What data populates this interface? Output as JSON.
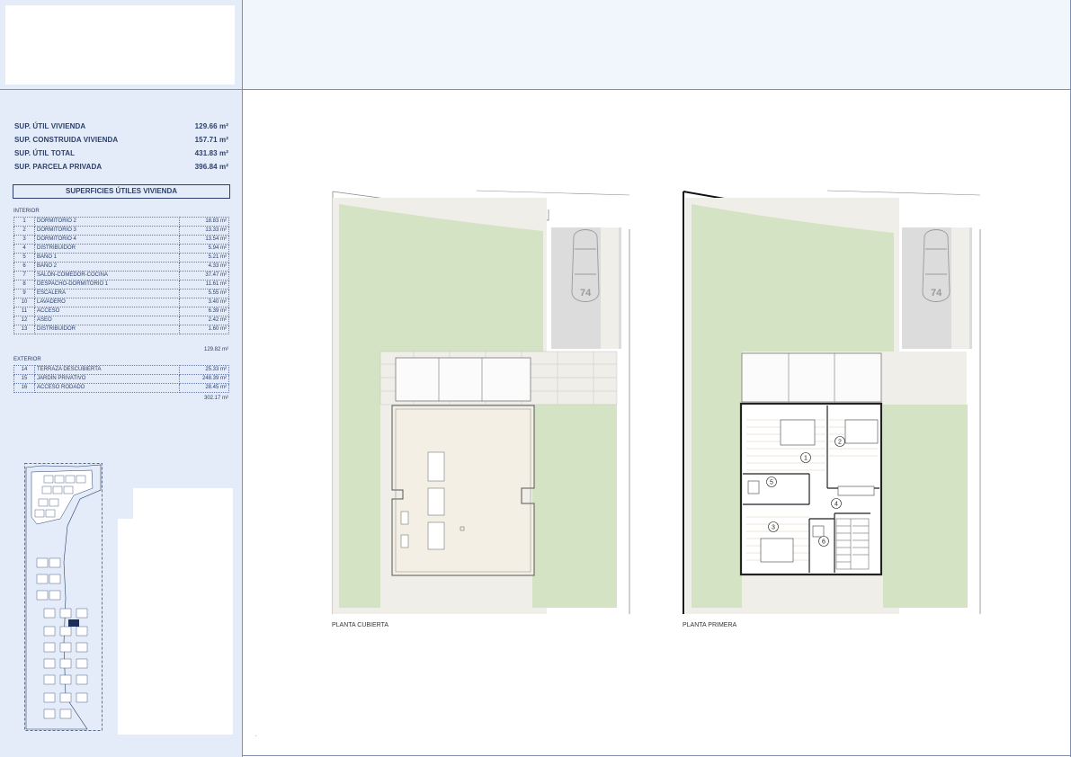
{
  "summary": [
    {
      "label": "SUP. ÚTIL VIVIENDA",
      "value": "129.66 m²"
    },
    {
      "label": "SUP. CONSTRUIDA VIVIENDA",
      "value": "157.71 m²"
    },
    {
      "label": "SUP. ÚTIL TOTAL",
      "value": "431.83 m²"
    },
    {
      "label": "SUP. PARCELA PRIVADA",
      "value": "396.84 m²"
    }
  ],
  "surfaces_title": "SUPERFICIES ÚTILES VIVIENDA",
  "interior": {
    "label": "INTERIOR",
    "rooms": [
      {
        "n": "1",
        "name": "DORMITORIO 2",
        "area": "18.83 m²"
      },
      {
        "n": "2",
        "name": "DORMITORIO 3",
        "area": "13.33 m²"
      },
      {
        "n": "3",
        "name": "DORMITORIO 4",
        "area": "13.54 m²"
      },
      {
        "n": "4",
        "name": "DISTRIBUIDOR",
        "area": "5.94 m²"
      },
      {
        "n": "5",
        "name": "BAÑO 1",
        "area": "5.21 m²"
      },
      {
        "n": "6",
        "name": "BAÑO 2",
        "area": "4.33 m²"
      },
      {
        "n": "7",
        "name": "SALÓN-COMEDOR-COCINA",
        "area": "37.47 m²"
      },
      {
        "n": "8",
        "name": "DESPACHO-DORMITORIO 1",
        "area": "11.61 m²"
      },
      {
        "n": "9",
        "name": "ESCALERA",
        "area": "5.55 m²"
      },
      {
        "n": "10",
        "name": "LAVADERO",
        "area": "3.40 m²"
      },
      {
        "n": "11",
        "name": "ACCESO",
        "area": "6.39 m²"
      },
      {
        "n": "12",
        "name": "ASEO",
        "area": "2.42 m²"
      },
      {
        "n": "13",
        "name": "DISTRIBUIDOR",
        "area": "1.60 m²"
      }
    ],
    "total": "129.82 m²"
  },
  "exterior": {
    "label": "EXTERIOR",
    "rooms": [
      {
        "n": "14",
        "name": "TERRAZA DESCUBIERTA",
        "area": "25.33 m²"
      },
      {
        "n": "15",
        "name": "JARDÍN PRIVATIVO",
        "area": "248.39 m²"
      },
      {
        "n": "16",
        "name": "ACCESO RODADO",
        "area": "28.45 m²"
      }
    ],
    "total": "302.17 m²"
  },
  "plans": {
    "left_label": "PLANTA CUBIERTA",
    "right_label": "PLANTA PRIMERA",
    "parking_number": "74",
    "room_markers": [
      "1",
      "2",
      "3",
      "4",
      "5",
      "6"
    ]
  },
  "footer_mark": ".",
  "colors": {
    "sidebar_bg": "#e3ecf8",
    "text_navy": "#2d3f6b",
    "garden_green": "#d4e3c4",
    "paving": "#efeee8",
    "roof": "#f4efe5",
    "parking_grey": "#dcdcdc",
    "highlight_unit": "#1c2e5c"
  }
}
